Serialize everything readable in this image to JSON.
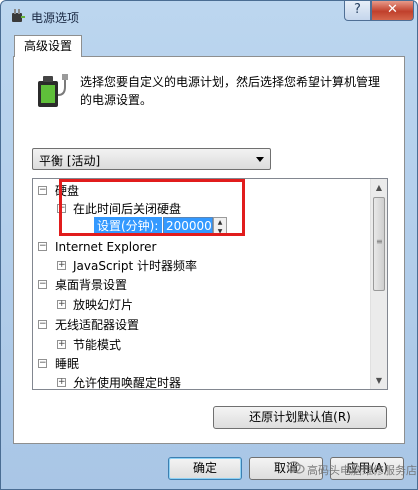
{
  "window": {
    "title": "电源选项",
    "help_glyph": "?",
    "close_glyph": "✕"
  },
  "tab": {
    "label": "高级设置"
  },
  "intro": "选择您要自定义的电源计划，然后选择您希望计算机管理的电源设置。",
  "plan_select": {
    "value": "平衡 [活动]"
  },
  "tree": {
    "hard_disk": "硬盘",
    "turn_off_after": "在此时间后关闭硬盘",
    "setting_label": "设置(分钟):",
    "setting_value": "2000000",
    "internet_explorer": "Internet Explorer",
    "javascript_timer": "JavaScript 计时器频率",
    "desktop_background": "桌面背景设置",
    "slideshow": "放映幻灯片",
    "wireless_adapter": "无线适配器设置",
    "power_saving_mode": "节能模式",
    "sleep": "睡眠",
    "allow_wake_timers": "允许使用唤醒定时器"
  },
  "buttons": {
    "restore": "还原计划默认值(R)",
    "ok": "确定",
    "cancel": "取消",
    "apply": "应用(A)"
  },
  "watermark": "高码头电脑维修服务店",
  "icons": {
    "app": "power-plug-icon",
    "panel": "battery-plug-icon",
    "watermark": "wechat-icon"
  },
  "colors": {
    "selection": "#3399ff",
    "highlight_box": "#e11c1c",
    "close_button": "#c0402c"
  }
}
